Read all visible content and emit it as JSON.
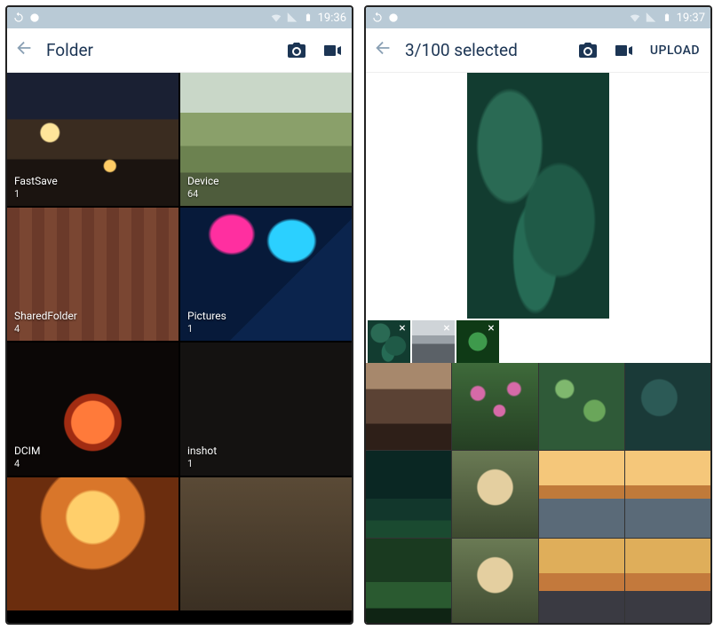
{
  "phone1": {
    "status": {
      "time": "19:36"
    },
    "appbar": {
      "title": "Folder"
    },
    "folders": [
      {
        "name": "FastSave",
        "count": "1"
      },
      {
        "name": "Device",
        "count": "64"
      },
      {
        "name": "SharedFolder",
        "count": "4"
      },
      {
        "name": "Pictures",
        "count": "1"
      },
      {
        "name": "DCIM",
        "count": "4"
      },
      {
        "name": "inshot",
        "count": "1"
      }
    ]
  },
  "phone2": {
    "status": {
      "time": "19:37"
    },
    "appbar": {
      "title": "3/100 selected",
      "upload": "UPLOAD"
    },
    "selected_thumbs": [
      {
        "kind": "leaves"
      },
      {
        "kind": "bw-mountain"
      },
      {
        "kind": "green-cluster"
      }
    ],
    "gallery": [
      "dusk-city",
      "flowers",
      "green-bokeh",
      "leaves-dim",
      "forest",
      "owl",
      "venice",
      "venice",
      "jungle-steps",
      "owl",
      "sunset-wide",
      "sunset-wide"
    ]
  },
  "accent_color": "#1c3554"
}
